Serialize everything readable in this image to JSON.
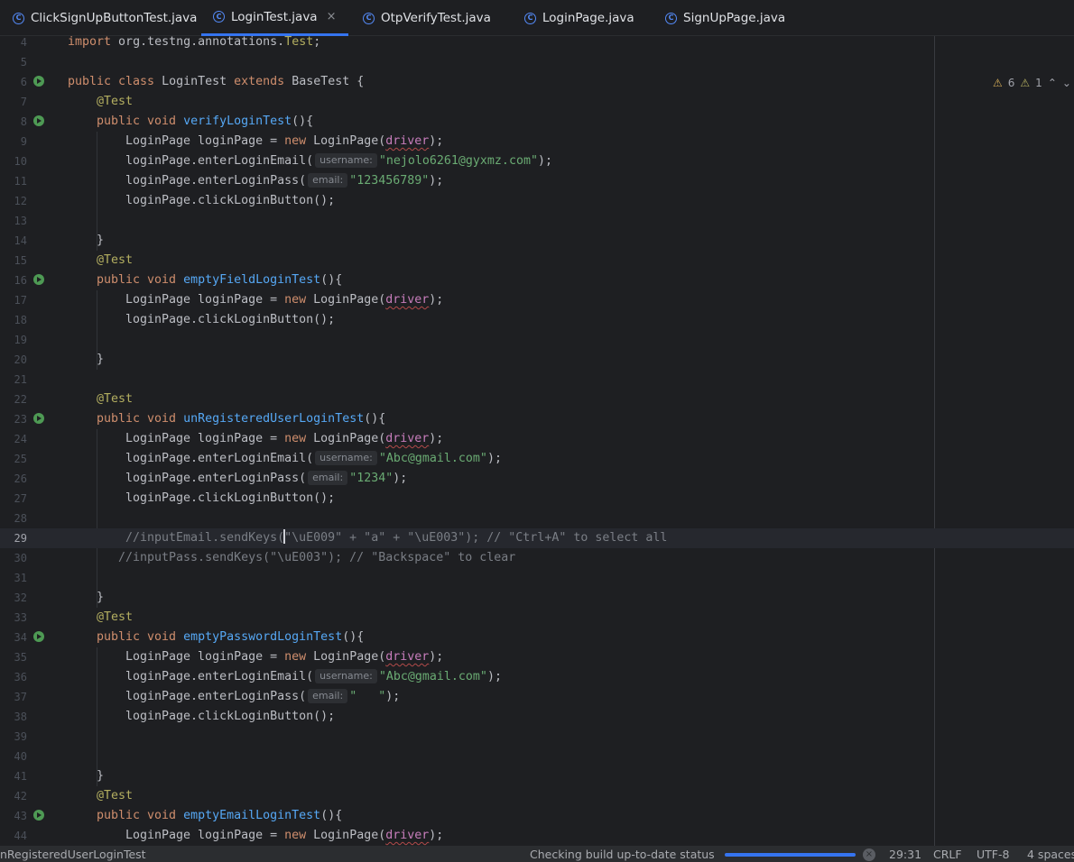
{
  "tabs": [
    {
      "label": "ClickSignUpButtonTest.java",
      "active": false
    },
    {
      "label": "LoginTest.java",
      "active": true
    },
    {
      "label": "OtpVerifyTest.java",
      "active": false
    },
    {
      "label": "LoginPage.java",
      "active": false
    },
    {
      "label": "SignUpPage.java",
      "active": false
    }
  ],
  "tab_icon_letter": "C",
  "close_glyph": "×",
  "inspections": {
    "warnings": "6",
    "weak_warnings": "1",
    "up_glyph": "⌃",
    "down_glyph": "⌄"
  },
  "hints": {
    "username": "username:",
    "email": "email:"
  },
  "lines": {
    "l4": {
      "n": "4",
      "a": "import",
      "b": " org.testng.annotations.",
      "c": "Test",
      "d": ";"
    },
    "l5": {
      "n": "5"
    },
    "l6": {
      "n": "6",
      "a": "public class",
      "b": " LoginTest ",
      "c": "extends",
      "d": " BaseTest {"
    },
    "l7": {
      "n": "7",
      "a": "@Test"
    },
    "l8": {
      "n": "8",
      "a": "public void",
      "b": "verifyLoginTest",
      "c": "(){"
    },
    "l9": {
      "n": "9",
      "a": "LoginPage loginPage = ",
      "b": "new",
      "c": " LoginPage(",
      "d": "driver",
      "e": ");"
    },
    "l10": {
      "n": "10",
      "a": "loginPage.enterLoginEmail(",
      "b": "\"nejolo6261@gyxmz.com\"",
      "c": ");"
    },
    "l11": {
      "n": "11",
      "a": "loginPage.enterLoginPass(",
      "b": "\"123456789\"",
      "c": ");"
    },
    "l12": {
      "n": "12",
      "a": "loginPage.clickLoginButton();"
    },
    "l13": {
      "n": "13"
    },
    "l14": {
      "n": "14",
      "a": "}"
    },
    "l15": {
      "n": "15",
      "a": "@Test"
    },
    "l16": {
      "n": "16",
      "a": "public void",
      "b": "emptyFieldLoginTest",
      "c": "(){"
    },
    "l17": {
      "n": "17",
      "a": "LoginPage loginPage = ",
      "b": "new",
      "c": " LoginPage(",
      "d": "driver",
      "e": ");"
    },
    "l18": {
      "n": "18",
      "a": "loginPage.clickLoginButton();"
    },
    "l19": {
      "n": "19"
    },
    "l20": {
      "n": "20",
      "a": "}"
    },
    "l21": {
      "n": "21"
    },
    "l22": {
      "n": "22",
      "a": "@Test"
    },
    "l23": {
      "n": "23",
      "a": "public void",
      "b": "unRegisteredUserLoginTest",
      "c": "(){"
    },
    "l24": {
      "n": "24",
      "a": "LoginPage loginPage = ",
      "b": "new",
      "c": " LoginPage(",
      "d": "driver",
      "e": ");"
    },
    "l25": {
      "n": "25",
      "a": "loginPage.enterLoginEmail(",
      "b": "\"Abc@gmail.com\"",
      "c": ");"
    },
    "l26": {
      "n": "26",
      "a": "loginPage.enterLoginPass(",
      "b": "\"1234\"",
      "c": ");"
    },
    "l27": {
      "n": "27",
      "a": "loginPage.clickLoginButton();"
    },
    "l28": {
      "n": "28"
    },
    "l29": {
      "n": "29",
      "a": "//inputEmail.sendKeys(",
      "b": "\"\\uE009\" + \"a\" + \"\\uE003\"); // \"Ctrl+A\" to select all"
    },
    "l30": {
      "n": "30",
      "a": "//inputPass.sendKeys(\"\\uE003\"); // \"Backspace\" to clear"
    },
    "l31": {
      "n": "31"
    },
    "l32": {
      "n": "32",
      "a": "}"
    },
    "l33": {
      "n": "33",
      "a": "@Test"
    },
    "l34": {
      "n": "34",
      "a": "public void",
      "b": "emptyPasswordLoginTest",
      "c": "(){"
    },
    "l35": {
      "n": "35",
      "a": "LoginPage loginPage = ",
      "b": "new",
      "c": " LoginPage(",
      "d": "driver",
      "e": ");"
    },
    "l36": {
      "n": "36",
      "a": "loginPage.enterLoginEmail(",
      "b": "\"Abc@gmail.com\"",
      "c": ");"
    },
    "l37": {
      "n": "37",
      "a": "loginPage.enterLoginPass(",
      "b": "\"   \"",
      "c": ");"
    },
    "l38": {
      "n": "38",
      "a": "loginPage.clickLoginButton();"
    },
    "l39": {
      "n": "39"
    },
    "l40": {
      "n": "40"
    },
    "l41": {
      "n": "41",
      "a": "}"
    },
    "l42": {
      "n": "42",
      "a": "@Test"
    },
    "l43": {
      "n": "43",
      "a": "public void",
      "b": "emptyEmailLoginTest",
      "c": "(){"
    },
    "l44": {
      "n": "44",
      "a": "LoginPage loginPage = ",
      "b": "new",
      "c": " LoginPage(",
      "d": "driver",
      "e": ");"
    }
  },
  "status": {
    "breadcrumb": "nRegisteredUserLoginTest",
    "task": "Checking build up-to-date status",
    "progress": 1.0,
    "cancel_glyph": "×",
    "position": "29:31",
    "line_sep": "CRLF",
    "encoding": "UTF-8",
    "indent": "4 spaces"
  },
  "colors": {
    "accent": "#3574f0",
    "keyword": "#cf8e6d",
    "annotation": "#b3ae60",
    "method": "#56a8f5",
    "string": "#6aab73",
    "field": "#c77dbb",
    "comment": "#7a7e85"
  }
}
